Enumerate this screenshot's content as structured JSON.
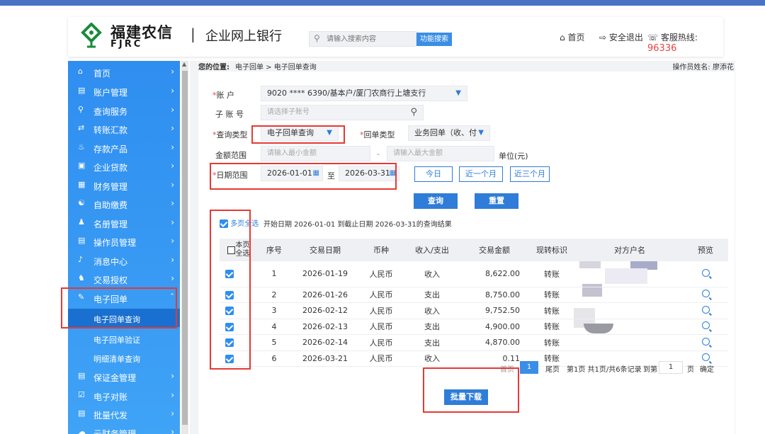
{
  "header": {
    "logo_cn": "福建农信",
    "logo_en": "FJRC",
    "separator": "|",
    "site_title": "企业网上银行",
    "search_placeholder": "请输入搜索内容",
    "func_search": "功能搜索",
    "home": "首页",
    "logout": "安全退出",
    "hotline_label": "客服热线:",
    "hotline_number": "96336"
  },
  "sidebar": {
    "items": [
      {
        "label": "首页",
        "icon": "home-icon"
      },
      {
        "label": "账户管理",
        "icon": "account-icon"
      },
      {
        "label": "查询服务",
        "icon": "search-icon"
      },
      {
        "label": "转账汇款",
        "icon": "transfer-icon"
      },
      {
        "label": "存款产品",
        "icon": "deposit-icon"
      },
      {
        "label": "企业贷款",
        "icon": "loan-icon"
      },
      {
        "label": "财务管理",
        "icon": "finance-icon"
      },
      {
        "label": "自助缴费",
        "icon": "payment-icon"
      },
      {
        "label": "名册管理",
        "icon": "roster-icon"
      },
      {
        "label": "操作员管理",
        "icon": "operator-icon"
      },
      {
        "label": "消息中心",
        "icon": "bell-icon"
      },
      {
        "label": "交易授权",
        "icon": "authorize-icon"
      },
      {
        "label": "电子回单",
        "icon": "receipt-icon"
      }
    ],
    "sub_items": [
      "电子回单查询",
      "电子回单验证",
      "明细清单查询"
    ],
    "bottom_items": [
      {
        "label": "保证金管理",
        "icon": "deposit-margin-icon"
      },
      {
        "label": "电子对账",
        "icon": "reconcile-icon"
      },
      {
        "label": "批量代发",
        "icon": "batch-icon"
      },
      {
        "label": "云财务管理",
        "icon": "cloud-icon"
      }
    ]
  },
  "breadcrumb": {
    "prefix": "您的位置:",
    "path": "电子回单 > 电子回单查询",
    "operator": "操作员姓名: 廖添花"
  },
  "form": {
    "account_label": "账    户",
    "account_value": "9020 **** 6390/基本户/厦门农商行上塘支行",
    "sub_account_label": "子 账 号",
    "sub_account_placeholder": "请选择子账号",
    "query_type_label": "查询类型",
    "query_type_value": "电子回单查询",
    "receipt_type_label": "回单类型",
    "receipt_type_value": "业务回单（收、付",
    "amount_label": "金额范围",
    "amount_min_placeholder": "请输入最小金额",
    "amount_dash": "-",
    "amount_max_placeholder": "请输入最大金额",
    "amount_unit": "单位(元)",
    "date_label": "日期范围",
    "date_start": "2026-01-01",
    "date_to": "至",
    "date_end": "2026-03-31",
    "btn_today": "今日",
    "btn_month": "近一个月",
    "btn_3months": "近三个月",
    "btn_query": "查询",
    "btn_reset": "重置"
  },
  "results": {
    "multi_select_label": "多页全选",
    "summary": "开始日期 2026-01-01 到截止日期 2026-03-31的查询结果",
    "headers": [
      "本页全选",
      "序号",
      "交易日期",
      "币种",
      "收入/支出",
      "交易金额",
      "现转标识",
      "对方户名",
      "预览"
    ],
    "rows": [
      {
        "no": "1",
        "date": "2026-01-19",
        "currency": "人民币",
        "direction": "收入",
        "amount": "8,622.00",
        "mode": "转账"
      },
      {
        "no": "2",
        "date": "2026-01-26",
        "currency": "人民币",
        "direction": "支出",
        "amount": "8,750.00",
        "mode": "转账"
      },
      {
        "no": "3",
        "date": "2026-02-12",
        "currency": "人民币",
        "direction": "收入",
        "amount": "9,752.50",
        "mode": "转账"
      },
      {
        "no": "4",
        "date": "2026-02-13",
        "currency": "人民币",
        "direction": "支出",
        "amount": "4,900.00",
        "mode": "转账"
      },
      {
        "no": "5",
        "date": "2026-02-14",
        "currency": "人民币",
        "direction": "支出",
        "amount": "4,870.00",
        "mode": "转账"
      },
      {
        "no": "6",
        "date": "2026-03-21",
        "currency": "人民币",
        "direction": "收入",
        "amount": "0.11",
        "mode": "转账"
      }
    ]
  },
  "pager": {
    "first": "首页",
    "current": "1",
    "last": "尾页",
    "page_info": "第1页 共1页/共6条记录",
    "goto": "到第",
    "goto_value": "1",
    "page_unit": "页",
    "confirm": "确定"
  },
  "batch_download": "批量下载",
  "colors": {
    "accent": "#2f7dd8",
    "sidebar": "#2f8ef0",
    "highlight": "#e53935"
  }
}
